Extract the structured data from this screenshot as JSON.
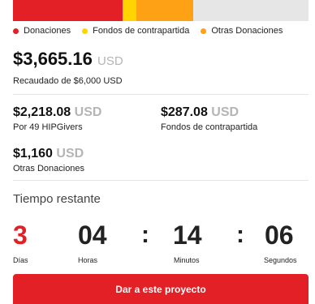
{
  "progress": {
    "goal": 6000,
    "segments": [
      {
        "name": "Donaciones",
        "value": 2218.08,
        "color": "#e32026"
      },
      {
        "name": "Fondos de contrapartida",
        "value": 287.08,
        "color": "#ffd400"
      },
      {
        "name": "Otras Donaciones",
        "value": 1160,
        "color": "#ffa114"
      }
    ],
    "remaining_color": "#e6e6e6"
  },
  "legend": [
    {
      "label": "Donaciones",
      "color": "#e32026"
    },
    {
      "label": "Fondos de contrapartida",
      "color": "#ffd400"
    },
    {
      "label": "Otras Donaciones",
      "color": "#ffa114"
    }
  ],
  "raised": {
    "amount": "$3,665.16",
    "currency": "USD",
    "caption": "Recaudado de $6,000 USD"
  },
  "donations": {
    "amount": "$2,218.08",
    "currency": "USD",
    "caption": "Por 49 HIPGivers"
  },
  "matching": {
    "amount": "$287.08",
    "currency": "USD",
    "caption": "Fondos de contrapartida"
  },
  "other": {
    "amount": "$1,160",
    "currency": "USD",
    "caption": "Otras Donaciones"
  },
  "time": {
    "title": "Tiempo restante",
    "days": "3",
    "days_label": "Días",
    "hours": "04",
    "hours_label": "Horas",
    "minutes": "14",
    "minutes_label": "Minutos",
    "seconds": "06",
    "seconds_label": "Segundos",
    "separator": ":"
  },
  "cta": {
    "label": "Dar a este proyecto"
  },
  "colors": {
    "accent": "#e32026",
    "muted": "#b5b5b5"
  }
}
